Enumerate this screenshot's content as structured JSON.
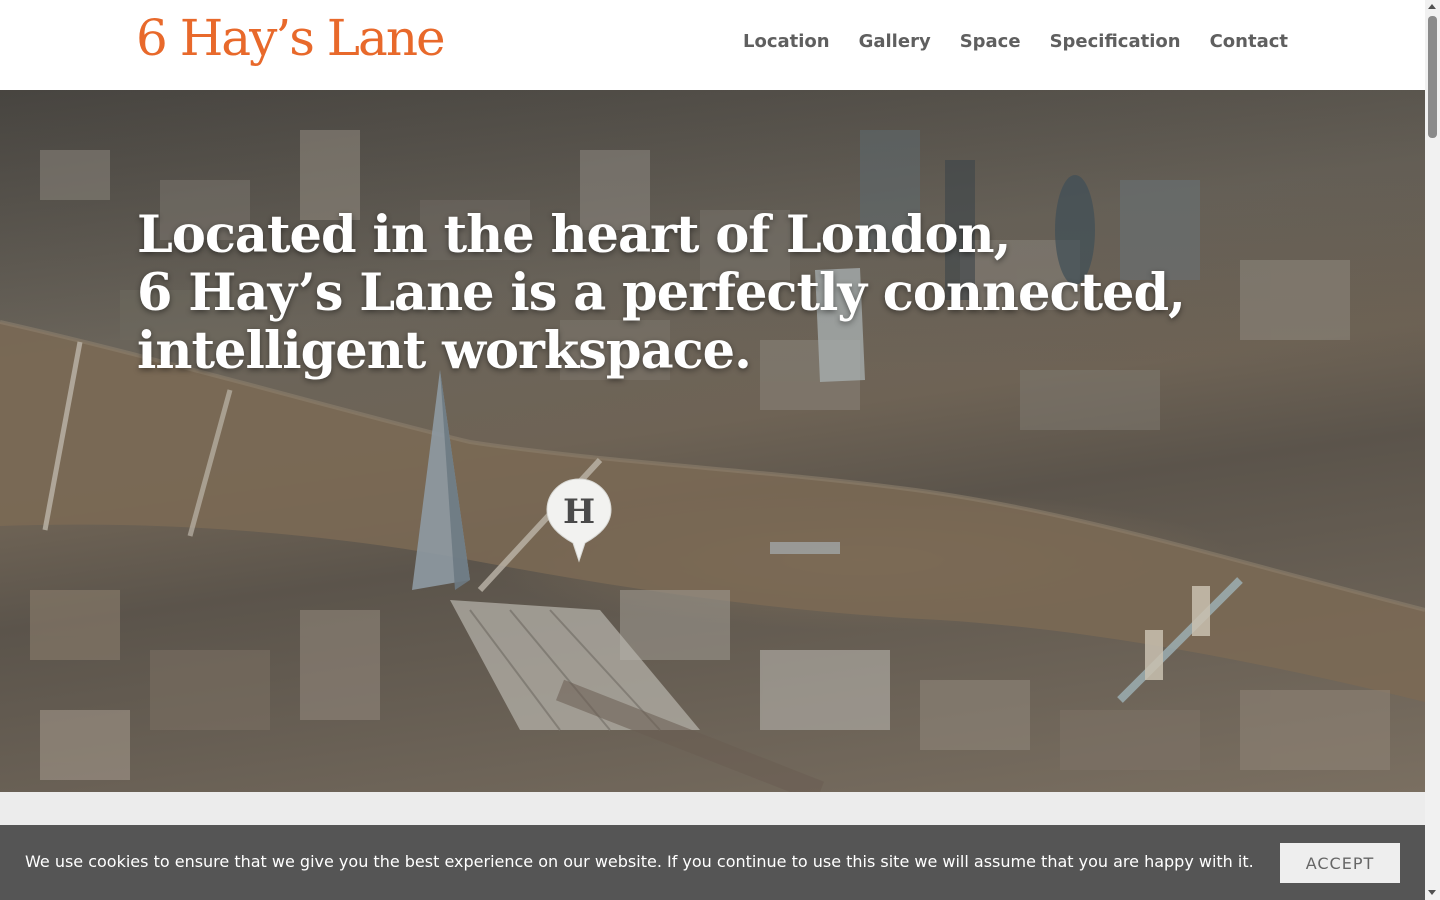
{
  "header": {
    "logo": "6 Hay’s Lane",
    "logo_color": "#e8692b",
    "nav": [
      {
        "label": "Location"
      },
      {
        "label": "Gallery"
      },
      {
        "label": "Space"
      },
      {
        "label": "Specification"
      },
      {
        "label": "Contact"
      }
    ]
  },
  "hero": {
    "headline_lines": [
      "Located in the heart of London,",
      "6 Hay’s Lane is a perfectly connected,",
      "intelligent workspace."
    ],
    "map_pin_letter": "H"
  },
  "cookie_bar": {
    "message": "We use cookies to ensure that we give you the best experience on our website. If you continue to use this site we will assume that you are happy with it.",
    "accept_label": "ACCEPT"
  },
  "scrollbar": {
    "up_icon": "scroll-up-arrow-icon",
    "down_icon": "scroll-down-arrow-icon"
  }
}
